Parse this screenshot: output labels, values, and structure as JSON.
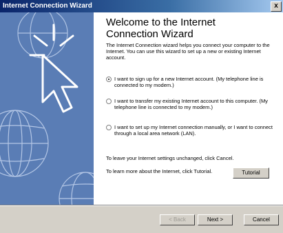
{
  "window": {
    "title": "Internet Connection Wizard",
    "close_glyph": "x"
  },
  "main": {
    "heading_line1": "Welcome to the Internet",
    "heading_line2": "Connection Wizard",
    "intro": "The Internet Connection wizard helps you connect your computer to the Internet. You can use this wizard to set up a new or existing Internet account.",
    "options": [
      {
        "label": "I want to sign up for a new Internet account. (My telephone line is connected to my modem.)",
        "selected": true
      },
      {
        "label": "I want to transfer my existing Internet account to this computer. (My telephone line is connected to my modem.)",
        "selected": false
      },
      {
        "label": "I want to set up my Internet connection manually, or I want to connect through a local area network (LAN).",
        "selected": false
      }
    ],
    "leave_text": "To leave your Internet settings unchanged, click Cancel.",
    "learn_text": "To learn more about the Internet, click Tutorial.",
    "tutorial_label": "Tutorial"
  },
  "footer": {
    "back_label": "< Back",
    "next_label": "Next >",
    "cancel_label": "Cancel"
  },
  "colors": {
    "sidebar": "#5a7db5",
    "titlebar": "#0a246a"
  }
}
